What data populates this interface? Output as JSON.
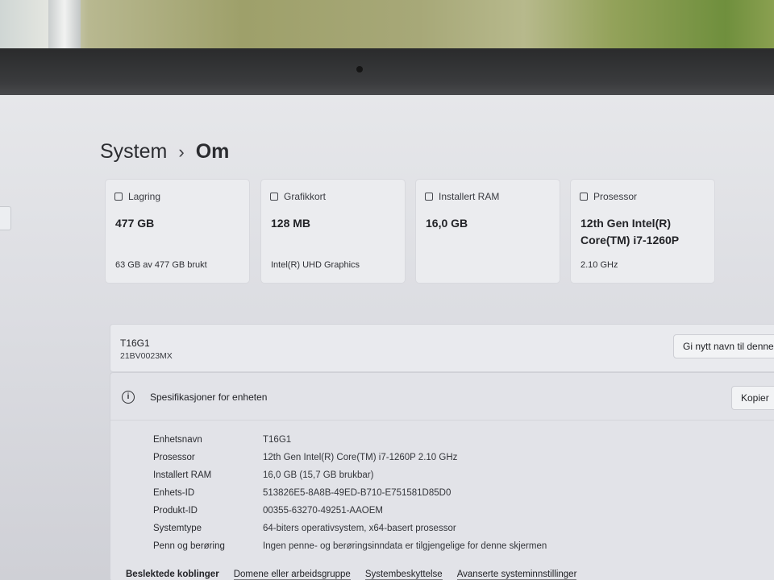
{
  "breadcrumb": {
    "parent": "System",
    "current": "Om"
  },
  "cards": [
    {
      "title": "Lagring",
      "value": "477 GB",
      "sub": "63 GB av 477 GB brukt",
      "icon": "storage-icon"
    },
    {
      "title": "Grafikkort",
      "value": "128 MB",
      "sub": "Intel(R) UHD Graphics",
      "icon": "display-card-icon"
    },
    {
      "title": "Installert RAM",
      "value": "16,0 GB",
      "sub": "",
      "icon": "ram-icon"
    },
    {
      "title": "Prosessor",
      "value": "12th Gen Intel(R) Core(TM) i7-1260P",
      "sub": "2.10 GHz",
      "icon": "processor-icon"
    }
  ],
  "device": {
    "name": "T16G1",
    "model": "21BV0023MX",
    "rename_label": "Gi nytt navn til denne"
  },
  "specs": {
    "title": "Spesifikasjoner for enheten",
    "copy_label": "Kopier",
    "rows": [
      {
        "key": "Enhetsnavn",
        "value": "T16G1"
      },
      {
        "key": "Prosessor",
        "value": "12th Gen Intel(R) Core(TM) i7-1260P   2.10 GHz"
      },
      {
        "key": "Installert RAM",
        "value": "16,0 GB (15,7 GB brukbar)"
      },
      {
        "key": "Enhets-ID",
        "value": "513826E5-8A8B-49ED-B710-E751581D85D0"
      },
      {
        "key": "Produkt-ID",
        "value": "00355-63270-49251-AAOEM"
      },
      {
        "key": "Systemtype",
        "value": "64-biters operativsystem, x64-basert prosessor"
      },
      {
        "key": "Penn og berøring",
        "value": "Ingen penne- og berøringsinndata er tilgjengelige for denne skjermen"
      }
    ]
  },
  "related": {
    "label": "Beslektede koblinger",
    "links": [
      "Domene eller arbeidsgruppe",
      "Systembeskyttelse",
      "Avanserte systeminnstillinger"
    ]
  }
}
